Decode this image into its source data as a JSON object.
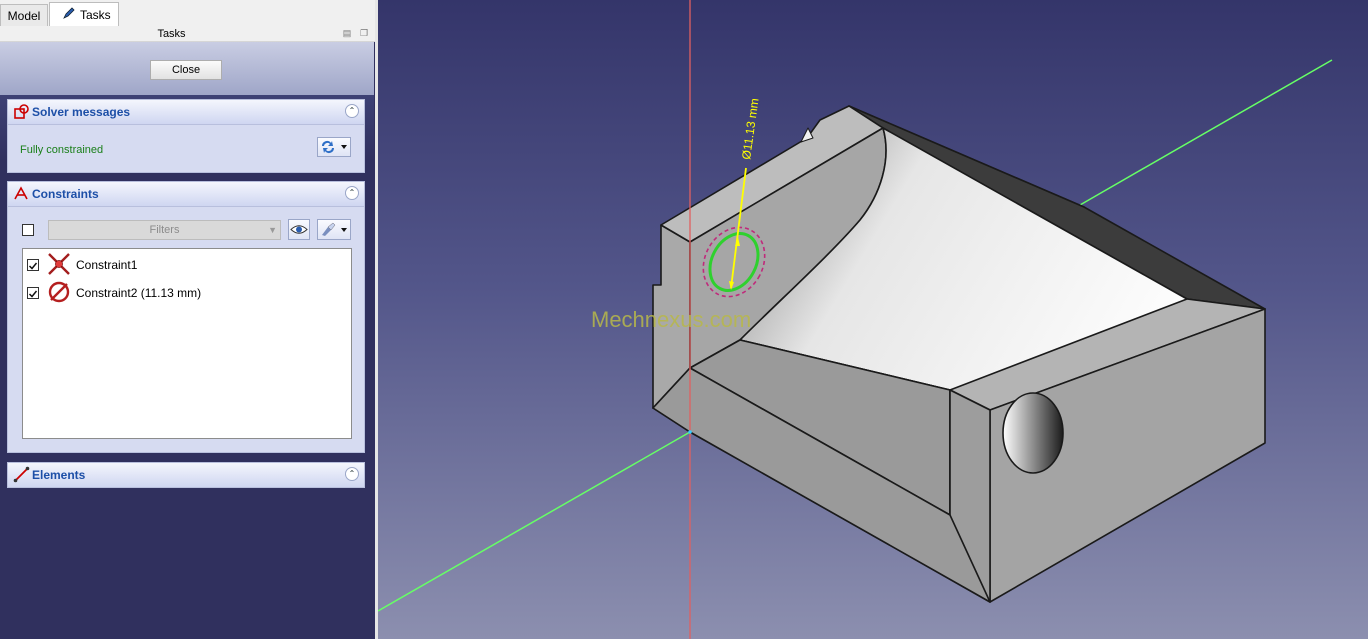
{
  "tabs": {
    "model": "Model",
    "tasks": "Tasks"
  },
  "panel_title": "Tasks",
  "close_label": "Close",
  "solver": {
    "title": "Solver messages",
    "status": "Fully constrained"
  },
  "constraints": {
    "title": "Constraints",
    "filter_placeholder": "Filters",
    "items": [
      {
        "label": "Constraint1",
        "checked": true,
        "icon": "coincident-constraint-icon"
      },
      {
        "label": "Constraint2 (11.13 mm)",
        "checked": true,
        "icon": "diameter-constraint-icon"
      }
    ]
  },
  "elements": {
    "title": "Elements"
  },
  "viewport": {
    "dimension_label": "Ø11.13 mm",
    "watermark": "Mechnexus.com"
  },
  "colors": {
    "status_ok": "#1a7f1a",
    "section_title": "#1d4fa7",
    "axis_x": "#e06060",
    "axis_green": "#66ff66",
    "sketch_green": "#2ed12e",
    "dimension": "#ffff00"
  }
}
